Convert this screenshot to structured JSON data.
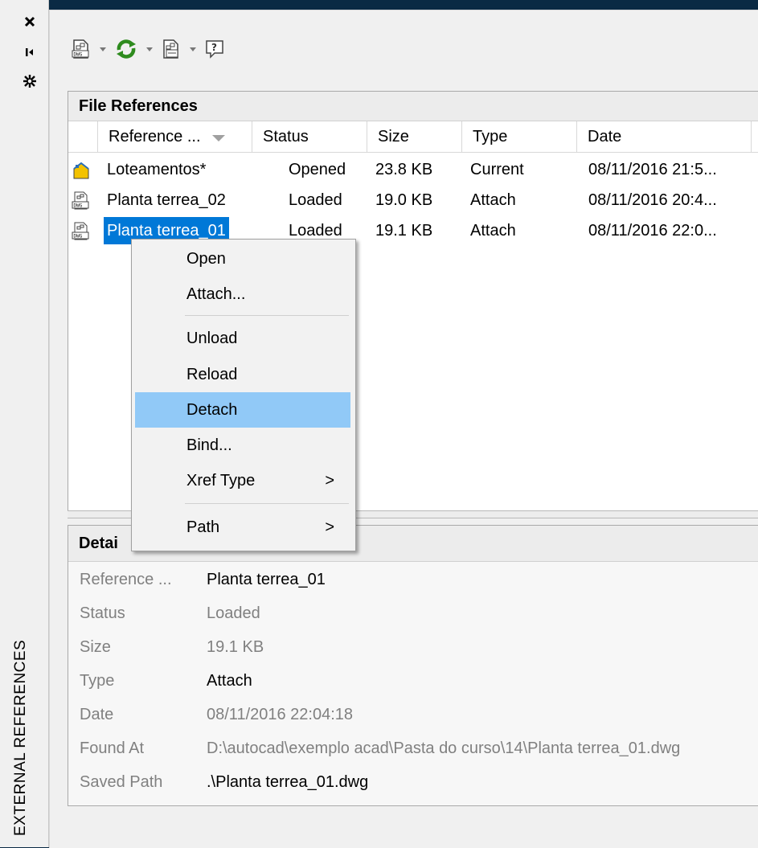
{
  "sidebar": {
    "title": "EXTERNAL REFERENCES",
    "buttons": [
      "close-icon",
      "auto-hide-icon",
      "properties-icon"
    ]
  },
  "toolbar": {
    "buttons": [
      "attach-dwg-icon",
      "refresh-icon",
      "change-path-icon",
      "help-icon"
    ]
  },
  "file_references": {
    "title": "File References",
    "columns": [
      "Reference ...",
      "Status",
      "Size",
      "Type",
      "Date"
    ],
    "rows": [
      {
        "name": "Loteamentos*",
        "status": "Opened",
        "size": "23.8 KB",
        "type": "Current",
        "date": "08/11/2016 21:5..."
      },
      {
        "name": "Planta terrea_02",
        "status": "Loaded",
        "size": "19.0 KB",
        "type": "Attach",
        "date": "08/11/2016 20:4..."
      },
      {
        "name": "Planta terrea_01",
        "status": "Loaded",
        "size": "19.1 KB",
        "type": "Attach",
        "date": "08/11/2016 22:0..."
      }
    ]
  },
  "details": {
    "title": "Detai",
    "rows": [
      {
        "label": "Reference ...",
        "value": "Planta terrea_01"
      },
      {
        "label": "Status",
        "value": "Loaded"
      },
      {
        "label": "Size",
        "value": "19.1 KB"
      },
      {
        "label": "Type",
        "value": "Attach"
      },
      {
        "label": "Date",
        "value": "08/11/2016 22:04:18"
      },
      {
        "label": "Found At",
        "value": "D:\\autocad\\exemplo acad\\Pasta do curso\\14\\Planta terrea_01.dwg"
      },
      {
        "label": "Saved Path",
        "value": ".\\Planta terrea_01.dwg"
      }
    ]
  },
  "context_menu": {
    "items": [
      "Open",
      "Attach...",
      "Unload",
      "Reload",
      "Detach",
      "Bind...",
      "Xref Type",
      "Path"
    ],
    "highlighted": "Detach",
    "submenu_arrow": ">"
  },
  "colors": {
    "selection": "#0078d7",
    "menu_highlight": "#91c9f7",
    "refresh_green": "#2e8b1e",
    "background": "#0a2a44"
  }
}
